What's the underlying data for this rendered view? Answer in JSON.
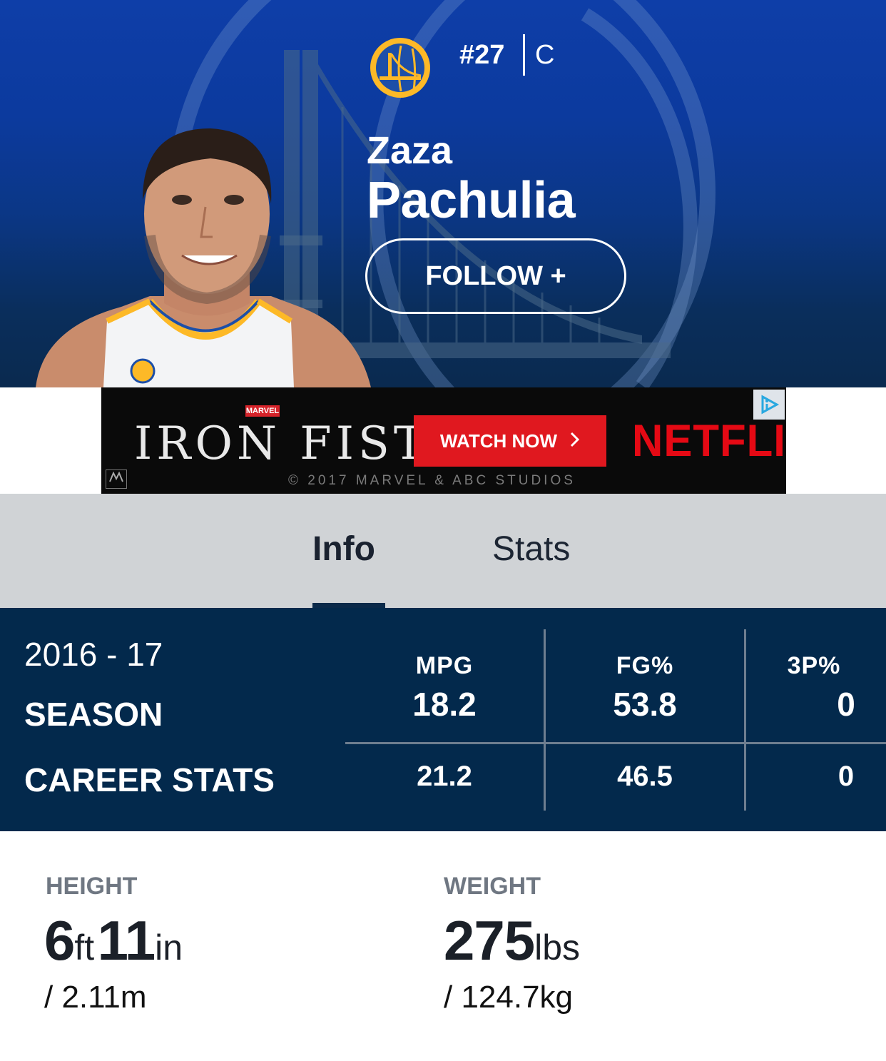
{
  "player": {
    "number": "#27",
    "position": "C",
    "first_name": "Zaza",
    "last_name": "Pachulia",
    "follow_label": "FOLLOW +"
  },
  "colors": {
    "team_blue": "#0e3ea8",
    "team_gold": "#fdb927",
    "stats_navy": "#03294c",
    "tab_bg": "#d0d3d6"
  },
  "ad": {
    "brand_tag": "MARVEL",
    "title": "IRON FIST",
    "cta_label": "WATCH NOW",
    "cta_icon": "chevron-right-icon",
    "network": "NETFLIX",
    "copyright": "© 2017 MARVEL & ABC STUDIOS",
    "choices_icon": "adchoices-icon"
  },
  "tabs": [
    {
      "label": "Info",
      "active": true
    },
    {
      "label": "Stats",
      "active": false
    }
  ],
  "stats": {
    "season_year": "2016 - 17",
    "season_label": "SEASON",
    "career_label": "CAREER STATS",
    "columns": [
      {
        "head": "MPG",
        "season": "18.2",
        "career": "21.2"
      },
      {
        "head": "FG%",
        "season": "53.8",
        "career": "46.5"
      },
      {
        "head": "3P%",
        "season": "0",
        "career": "0"
      }
    ]
  },
  "bio": {
    "height": {
      "label": "HEIGHT",
      "feet": "6",
      "feet_unit": "ft",
      "inches": "11",
      "inches_unit": "in",
      "metric": "/ 2.11m"
    },
    "weight": {
      "label": "WEIGHT",
      "value": "275",
      "unit": "lbs",
      "metric": "/ 124.7kg"
    }
  }
}
